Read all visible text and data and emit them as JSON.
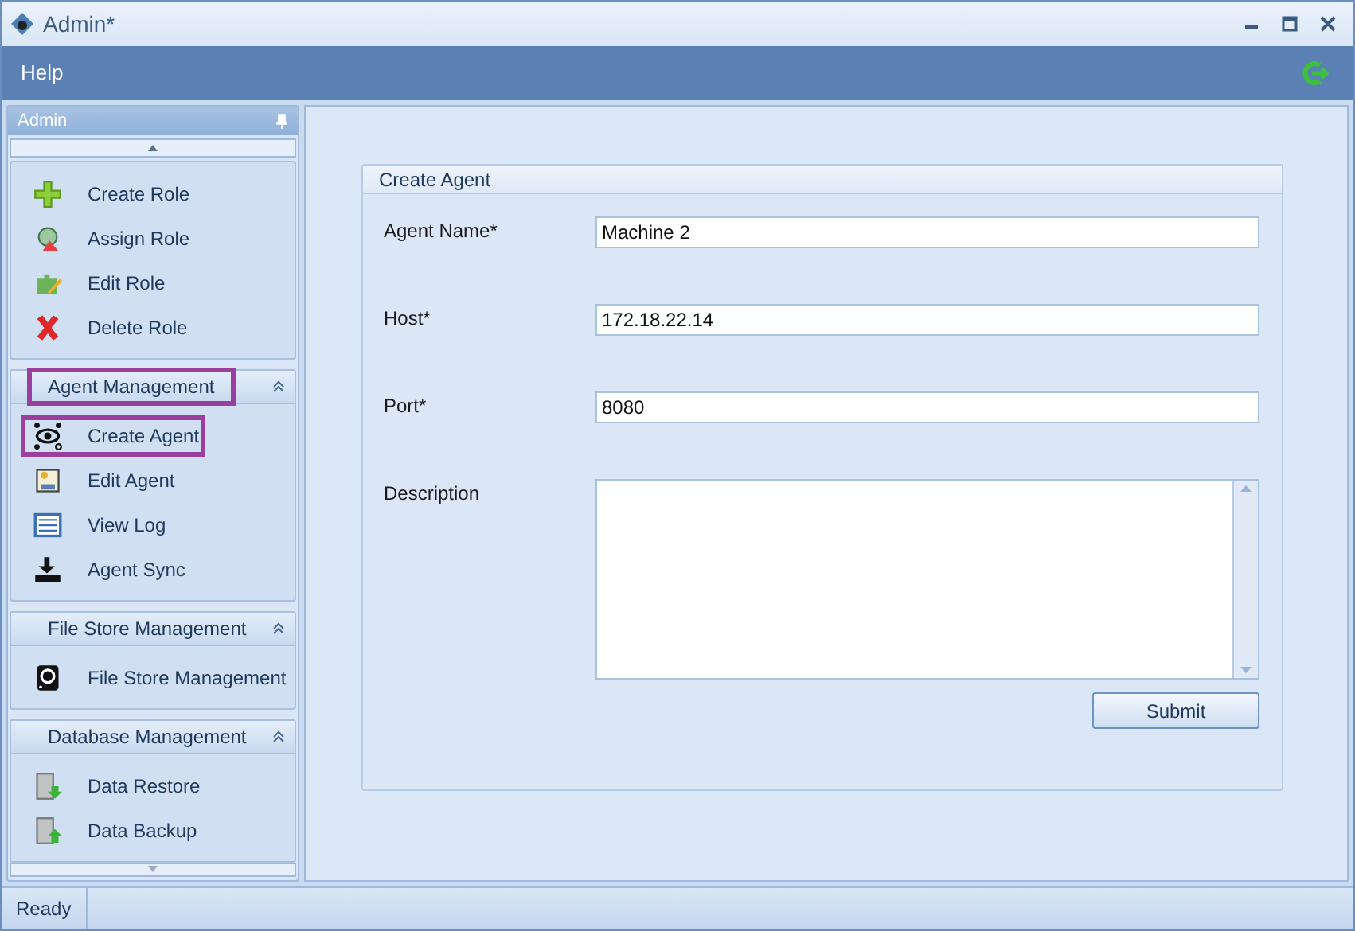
{
  "window": {
    "title": "Admin*"
  },
  "menu": {
    "items": [
      "Help"
    ]
  },
  "sidebar": {
    "title": "Admin",
    "groups": [
      {
        "items": [
          {
            "label": "Create Role",
            "highlighted": false
          },
          {
            "label": "Assign Role",
            "highlighted": false
          },
          {
            "label": "Edit Role",
            "highlighted": false
          },
          {
            "label": "Delete Role",
            "highlighted": false
          }
        ]
      },
      {
        "title": "Agent Management",
        "highlighted": true,
        "items": [
          {
            "label": "Create Agent",
            "highlighted": true
          },
          {
            "label": "Edit Agent",
            "highlighted": false
          },
          {
            "label": "View Log",
            "highlighted": false
          },
          {
            "label": "Agent Sync",
            "highlighted": false
          }
        ]
      },
      {
        "title": "File Store Management",
        "highlighted": false,
        "items": [
          {
            "label": "File Store Management",
            "highlighted": false
          }
        ]
      },
      {
        "title": "Database Management",
        "highlighted": false,
        "items": [
          {
            "label": "Data Restore",
            "highlighted": false
          },
          {
            "label": "Data Backup",
            "highlighted": false
          }
        ]
      }
    ]
  },
  "form": {
    "title": "Create Agent",
    "fields": [
      {
        "label": "Agent Name*",
        "value": "Machine 2",
        "kind": "text"
      },
      {
        "label": "Host*",
        "value": "172.18.22.14",
        "kind": "text"
      },
      {
        "label": "Port*",
        "value": "8080",
        "kind": "text"
      },
      {
        "label": "Description",
        "kind": "textarea"
      }
    ],
    "submit": "Submit"
  },
  "status_bar": {
    "text": "Ready"
  }
}
